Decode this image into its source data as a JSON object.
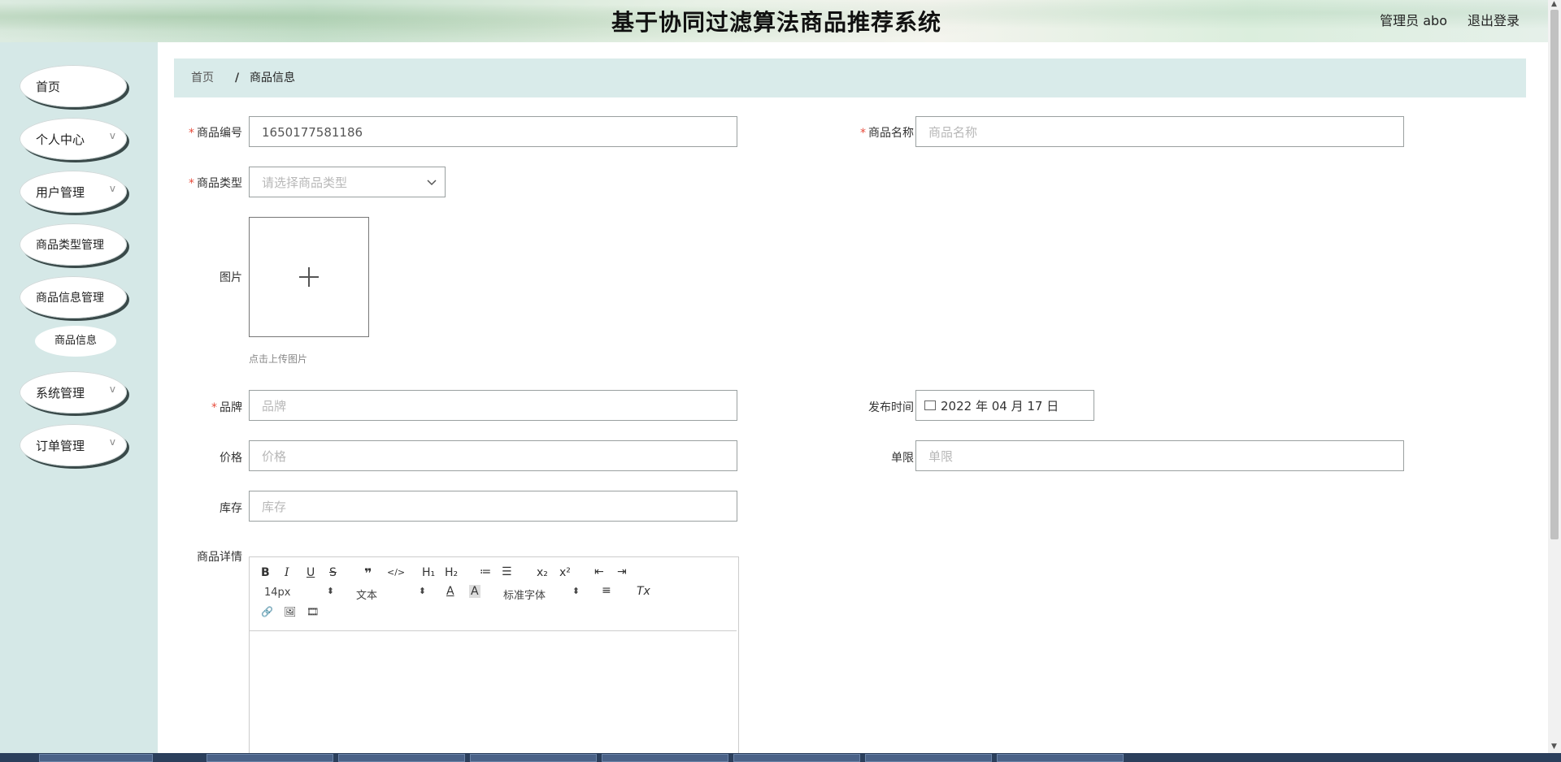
{
  "header": {
    "title": "基于协同过滤算法商品推荐系统",
    "user": "管理员 abo",
    "logout": "退出登录"
  },
  "sidebar": {
    "items": [
      {
        "label": "首页",
        "has_children": false
      },
      {
        "label": "个人中心",
        "has_children": true
      },
      {
        "label": "用户管理",
        "has_children": true
      },
      {
        "label": "商品类型管理",
        "has_children": false
      },
      {
        "label": "商品信息管理",
        "has_children": false
      },
      {
        "label": "系统管理",
        "has_children": true
      },
      {
        "label": "订单管理",
        "has_children": true
      }
    ],
    "sub_item": "商品信息",
    "chevron": "v"
  },
  "breadcrumb": {
    "home": "首页",
    "separator": "/",
    "current": "商品信息"
  },
  "form": {
    "product_code": {
      "label": "商品编号",
      "value": "1650177581186"
    },
    "product_name": {
      "label": "商品名称",
      "placeholder": "商品名称"
    },
    "product_type": {
      "label": "商品类型",
      "placeholder": "请选择商品类型"
    },
    "image": {
      "label": "图片",
      "hint": "点击上传图片"
    },
    "brand": {
      "label": "品牌",
      "placeholder": "品牌"
    },
    "publish_time": {
      "label": "发布时间",
      "value": "2022 年 04 月 17 日"
    },
    "price": {
      "label": "价格",
      "placeholder": "价格"
    },
    "unit_limit": {
      "label": "单限",
      "placeholder": "单限"
    },
    "stock": {
      "label": "库存",
      "placeholder": "库存"
    },
    "details": {
      "label": "商品详情"
    }
  },
  "editor_toolbar": {
    "bold": "B",
    "italic": "I",
    "underline": "U",
    "strike": "S",
    "quote": "❞",
    "code": "</>",
    "h1": "H₁",
    "h2": "H₂",
    "ordered_list": "≔",
    "bullet_list": "☰",
    "sub": "x₂",
    "sup": "x²",
    "outdent": "⇤",
    "indent": "⇥",
    "size": "14px",
    "format": "文本",
    "font_color": "A",
    "background": "A",
    "font_family": "标准字体",
    "align": "≡",
    "clear_format": "Tx",
    "link": "🔗",
    "image": "🖼",
    "video": "🎞"
  },
  "colors": {
    "sidebar_bg": "#d5e8e7",
    "breadcrumb_bg": "#d9ebea",
    "required": "#e74c3c"
  }
}
